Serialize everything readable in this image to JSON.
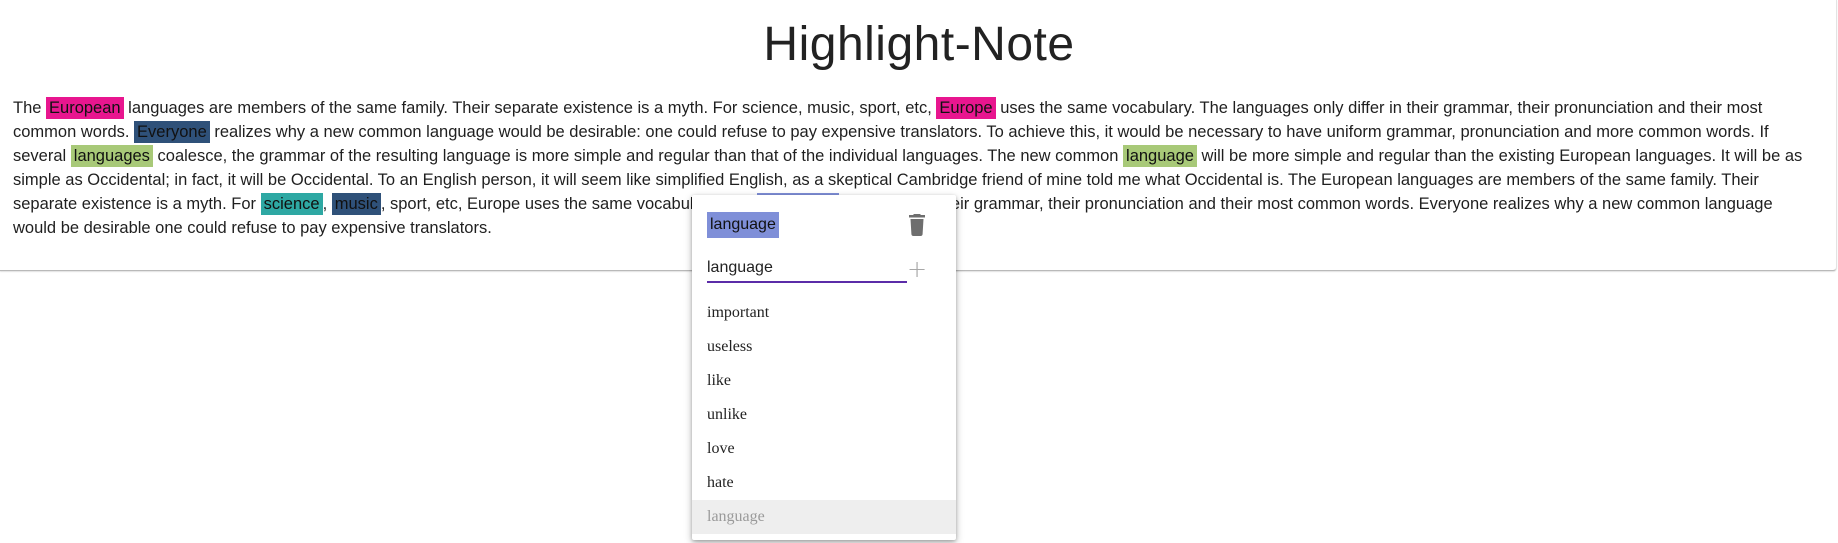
{
  "app": {
    "title": "Highlight-Note"
  },
  "colors": {
    "pink": "#e8168f",
    "navy": "#2f5179",
    "green": "#a8c978",
    "teal": "#2ea8a3",
    "periwinkle": "#7f8fd8",
    "input_underline": "#5b2ca8"
  },
  "text": {
    "s1": "The ",
    "h1": "European",
    "s2": " languages are members of the same family. Their separate existence is a myth. For science, music, sport, etc, ",
    "h2": "Europe",
    "s3": " uses the same vocabulary. The languages only differ in their grammar, their pronunciation and their most common words. ",
    "h3": "Everyone",
    "s4": " realizes why a new common language would be desirable: one could refuse to pay expensive translators. To achieve this, it would be necessary to have uniform grammar, pronunciation and more common words. If several ",
    "h4": "languages",
    "s5": " coalesce, the grammar of the resulting language is more simple and regular than that of the individual languages. The new common ",
    "h5": "language",
    "s6": " will be more simple and regular than the existing European languages. It will be as simple as Occidental; in fact, it will be Occidental. To an English person, it will seem like simplified English, as a skeptical Cambridge friend of mine told me what Occidental is. The European languages are members of the same family. Their separate existence is a myth. For ",
    "h6": "science",
    "s7": ", ",
    "h7": "music",
    "s8": ", sport, etc, Europe uses the same vocabulary. The ",
    "h8": "languages",
    "s9": " only differ in their grammar, their pronunciation and their most common words. Everyone realizes why a new common language would be desirable one could refuse to pay expensive translators."
  },
  "popup": {
    "selected_tag": "language",
    "delete_icon": "trash-icon",
    "input_value": "language",
    "add_icon": "plus-icon",
    "add_glyph": "+",
    "suggestions": [
      "important",
      "useless",
      "like",
      "unlike",
      "love",
      "hate",
      "language"
    ],
    "active_suggestion_index": 6
  }
}
